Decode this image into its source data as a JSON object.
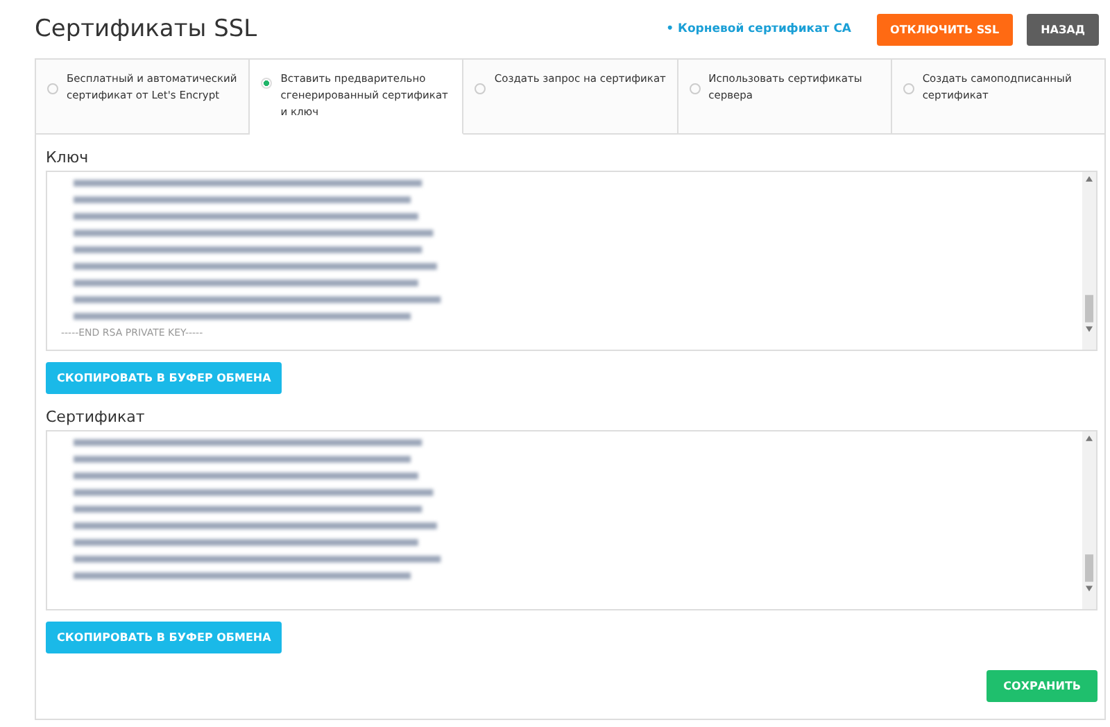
{
  "title": "Сертификаты SSL",
  "header_link": "• Корневой сертификат CA",
  "header_buttons": [
    {
      "label": "ОТКЛЮЧИТЬ SSL",
      "kind": "danger"
    },
    {
      "label": "НАЗАД",
      "kind": "muted"
    }
  ],
  "tabs": [
    {
      "label": "Бесплатный и автоматический сертификат от Let's Encrypt",
      "selected": false
    },
    {
      "label": "Вставить предварительно сгенерированный сертификат и ключ",
      "selected": true
    },
    {
      "label": "Создать запрос на сертификат",
      "selected": false
    },
    {
      "label": "Использовать сертификаты сервера",
      "selected": false
    },
    {
      "label": "Создать самоподписанный сертификат",
      "selected": false
    }
  ],
  "fields": [
    {
      "label": "Ключ",
      "last_line": "-----END RSA PRIVATE KEY-----",
      "button": "СКОПИРОВАТЬ В БУФЕР ОБМЕНА"
    },
    {
      "label": "Сертификат",
      "button": "СКОПИРОВАТЬ В БУФЕР ОБМЕНА"
    }
  ],
  "save_button": "СОХРАНИТЬ"
}
